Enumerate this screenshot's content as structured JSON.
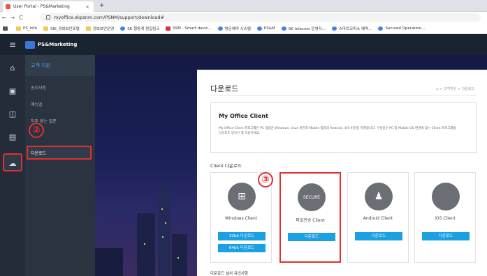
{
  "browser": {
    "tab_title": "User Portal - PS&Marketing",
    "tab_close": "×",
    "new_tab": "+",
    "url": "myoffice.skpsnm.com/PSNM/support/download#",
    "bookmarks": [
      {
        "label": "PS_Info",
        "icon": "folder"
      },
      {
        "label": "SKI_정보보안포털",
        "icon": "folder"
      },
      {
        "label": "정보보안운영",
        "icon": "folder"
      },
      {
        "label": "SK 행동계 편집링크",
        "icon": "blue"
      },
      {
        "label": "SSM - Smart devic...",
        "icon": "red"
      },
      {
        "label": "방문예약 시스템",
        "icon": "blue"
      },
      {
        "label": "PS&M",
        "icon": "blue"
      },
      {
        "label": "SK telecom 운영자...",
        "icon": "blue"
      },
      {
        "label": "스마트오피스 예약...",
        "icon": "blue"
      },
      {
        "label": "Secured Operation...",
        "icon": "blue"
      }
    ]
  },
  "app": {
    "logo_text": "PS&Marketing",
    "section_title": "고객 지원",
    "menu": [
      "공지사항",
      "매뉴얼",
      "자주 묻는 질문",
      "다운로드"
    ]
  },
  "page": {
    "title": "다운로드",
    "breadcrumb": "⌂ > 고객지원 > 다운로드",
    "info_title": "My Office Client",
    "info_text": "My Office Client 프로그램은 PC 접점은 Windows, linux 버전과 Mobile 접점의 Android, iOS 버전을 지원합니다. 구성중인 PC 및 Mobile OS 환경에 맞는 Client 프로그램을 다운로드 받으신 후 이용하세요.",
    "section_client": "Client 다운로드",
    "clients": [
      {
        "name": "Windows Client",
        "icon": "windows-icon",
        "buttons": [
          "32bit 다운로드",
          "64bit 다운로드"
        ]
      },
      {
        "name": "파일전송 Client",
        "icon": "secure-transfer-icon",
        "buttons": [
          "다운로드"
        ]
      },
      {
        "name": "Android Client",
        "icon": "android-icon",
        "buttons": [
          "다운로드"
        ]
      },
      {
        "name": "iOS Client",
        "icon": "apple-icon",
        "buttons": [
          "다운로드"
        ]
      }
    ],
    "footnote": "다운로드 설치 유의사항"
  },
  "annotations": {
    "step2": "②",
    "step3": "③"
  },
  "colors": {
    "highlight": "#e03030",
    "button": "#1ba1e2",
    "header": "#1a2330"
  }
}
